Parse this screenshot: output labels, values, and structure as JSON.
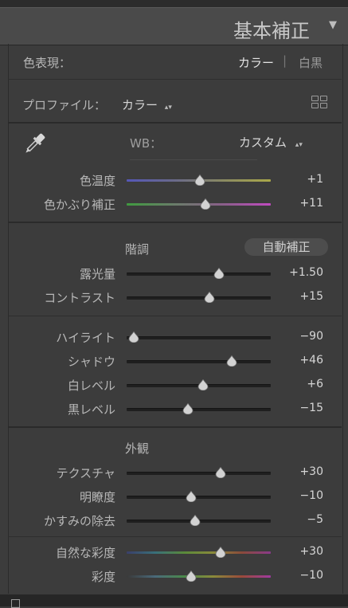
{
  "panel": {
    "title": "基本補正",
    "toggle_icon": "triangle-down"
  },
  "treatment": {
    "label": "色表現：",
    "color": "カラー",
    "divider": "|",
    "bw": "白黒"
  },
  "profile": {
    "label": "プロファイル：",
    "value": "カラー",
    "arrows": "⌃⌄"
  },
  "wb": {
    "label": "WB：",
    "value": "カスタム",
    "arrows": "⌃⌄"
  },
  "tone": {
    "heading": "階調",
    "auto_button": "自動補正"
  },
  "presence": {
    "heading": "外観"
  },
  "sliders": {
    "temp": {
      "label": "色温度",
      "value": "+1",
      "fraction": 0.51
    },
    "tint": {
      "label": "色かぶり補正",
      "value": "+11",
      "fraction": 0.545
    },
    "exposure": {
      "label": "露光量",
      "value": "+1.50",
      "fraction": 0.64
    },
    "contrast": {
      "label": "コントラスト",
      "value": "+15",
      "fraction": 0.575
    },
    "highlights": {
      "label": "ハイライト",
      "value": "−90",
      "fraction": 0.05
    },
    "shadows": {
      "label": "シャドウ",
      "value": "+46",
      "fraction": 0.73
    },
    "whites": {
      "label": "白レベル",
      "value": "+6",
      "fraction": 0.53
    },
    "blacks": {
      "label": "黒レベル",
      "value": "−15",
      "fraction": 0.425
    },
    "texture": {
      "label": "テクスチャ",
      "value": "+30",
      "fraction": 0.65
    },
    "clarity": {
      "label": "明瞭度",
      "value": "−10",
      "fraction": 0.45
    },
    "dehaze": {
      "label": "かすみの除去",
      "value": "−5",
      "fraction": 0.475
    },
    "vibrance": {
      "label": "自然な彩度",
      "value": "+30",
      "fraction": 0.65
    },
    "saturation": {
      "label": "彩度",
      "value": "−10",
      "fraction": 0.45
    }
  },
  "icons": {
    "eyedropper": "eyedropper-icon",
    "profile_browser": "grid-icon"
  }
}
